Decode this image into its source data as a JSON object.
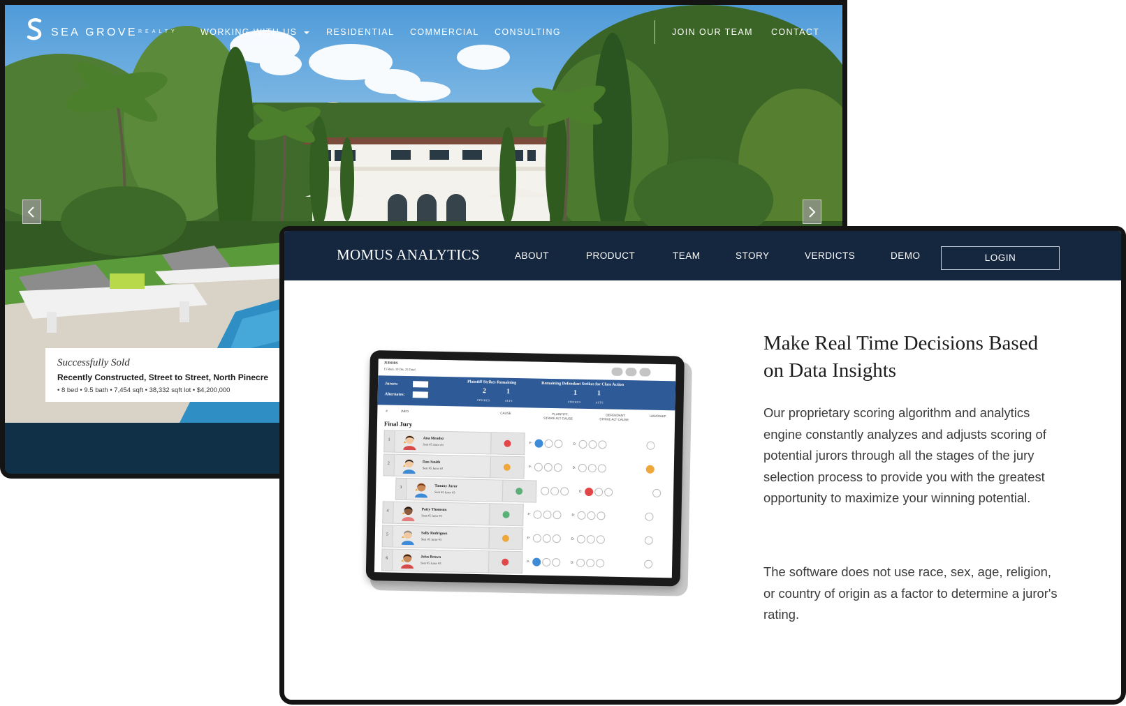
{
  "sea_grove": {
    "brand": "SEA GROVE",
    "brand_sub": "REALTY",
    "nav": [
      "WORKING WITH US",
      "RESIDENTIAL",
      "COMMERCIAL",
      "CONSULTING",
      "JOIN OUR TEAM",
      "CONTACT"
    ],
    "card": {
      "status": "Successfully Sold",
      "title": "Recently Constructed, Street to Street, North Pinecre",
      "details": "• 8 bed  • 9.5 bath  • 7,454 sqft  • 38,332 sqft lot  • $4,200,000"
    }
  },
  "momus": {
    "brand": "MOMUS ANALYTICS",
    "nav": [
      "ABOUT",
      "PRODUCT",
      "TEAM",
      "STORY",
      "VERDICTS",
      "DEMO"
    ],
    "login": "LOGIN",
    "heading": "Make Real Time Decisions Based on Data Insights",
    "paragraph_1": "Our proprietary scoring algorithm and analytics engine constantly analyzes and adjusts scoring of potential jurors through all the stages of the jury selection process to provide you with the greatest opportunity to maximize your winning potential.",
    "paragraph_2": "The software does not use race, sex, age, religion, or country of origin as a factor to determine a juror's rating."
  },
  "tablet": {
    "jurors_label": "JURORS",
    "jurors_count": "15 Rem.  10 Dis.  25 Total",
    "jurors_field": "Jurors:",
    "alternates_field": "Alternates:",
    "plaintiff_header": "Plaintiff Strikes Remaining",
    "defendant_header": "Remaining Defendant Strikes for Class Action",
    "plaintiff_strikes": "2",
    "plaintiff_alts": "1",
    "defendant_strikes": "1",
    "defendant_alts": "1",
    "strikes_label": "STRIKES",
    "alts_label": "ALTS",
    "col_num": "#",
    "col_info": "INFO",
    "col_cause": "CAUSE",
    "col_plaintiff": "PLAINTIFF:",
    "col_plaintiff_sub": "STRIKE  ALT  CAUSE",
    "col_defendant": "DEFENDANT:",
    "col_defendant_sub": "STRIKE  ALT  CAUSE",
    "col_hardship": "HARDSHIP",
    "final_jury": "Final Jury",
    "p_label": "P:",
    "d_label": "D:",
    "jurors": [
      {
        "num": "1",
        "name": "Ana Mendez",
        "seat": "Seat #5 Juror #3"
      },
      {
        "num": "2",
        "name": "Dan Smith",
        "seat": "Seat #5 Juror #3"
      },
      {
        "num": "3",
        "name": "Tammy Juror",
        "seat": "Seat #5 Juror #3"
      },
      {
        "num": "4",
        "name": "Patty Thomson",
        "seat": "Seat #5 Juror #3"
      },
      {
        "num": "5",
        "name": "Sally Rodriguez",
        "seat": "Seat #5 Juror #3"
      },
      {
        "num": "6",
        "name": "John Brown",
        "seat": "Seat #5 Juror #3"
      }
    ]
  },
  "colors": {
    "momus_nav": "#15263f",
    "sea_grove_footer": "#0f3047",
    "tablet_band": "#2e5a97",
    "strike_blue": "#3d8bd6",
    "strike_red": "#e24646",
    "badge_orange": "#efa73a",
    "badge_green": "#5bb07a"
  }
}
